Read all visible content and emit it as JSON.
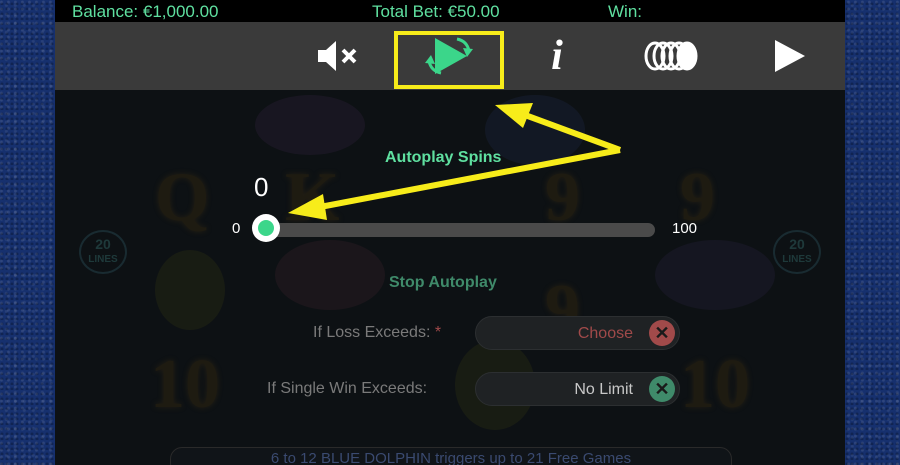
{
  "topbar": {
    "balance": "Balance: €1,000.00",
    "total_bet": "Total Bet: €50.00",
    "win": "Win:"
  },
  "toolbar": {
    "icons": [
      "mute-icon",
      "autoplay-icon",
      "info-icon",
      "coins-icon",
      "play-icon"
    ],
    "info_glyph": "i"
  },
  "autoplay": {
    "label": "Autoplay Spins",
    "value": "0",
    "min": "0",
    "max": "100",
    "level": 0
  },
  "stop_autoplay": {
    "label": "Stop Autoplay",
    "loss_label": "If Loss Exceeds:",
    "loss_required": "*",
    "loss_value": "Choose",
    "single_win_label": "If Single Win Exceeds:",
    "single_win_value": "No Limit",
    "clear_glyph": "✕"
  },
  "reels": {
    "symbols": [
      "Q",
      "K",
      "9",
      "9",
      "10",
      "10",
      "9"
    ],
    "lines_badge_top": "20",
    "lines_badge_bottom": "LINES"
  },
  "banner": {
    "text": "6 to 12 BLUE DOLPHIN triggers up to 21 Free Games"
  },
  "colors": {
    "accent_green": "#5fe0a0",
    "highlight_yellow": "#f7ec1a",
    "loss_value": "#a04a4a",
    "win_value": "#c8c8c8",
    "clear_red": "#a14a4a",
    "clear_green": "#3f8a6a"
  }
}
